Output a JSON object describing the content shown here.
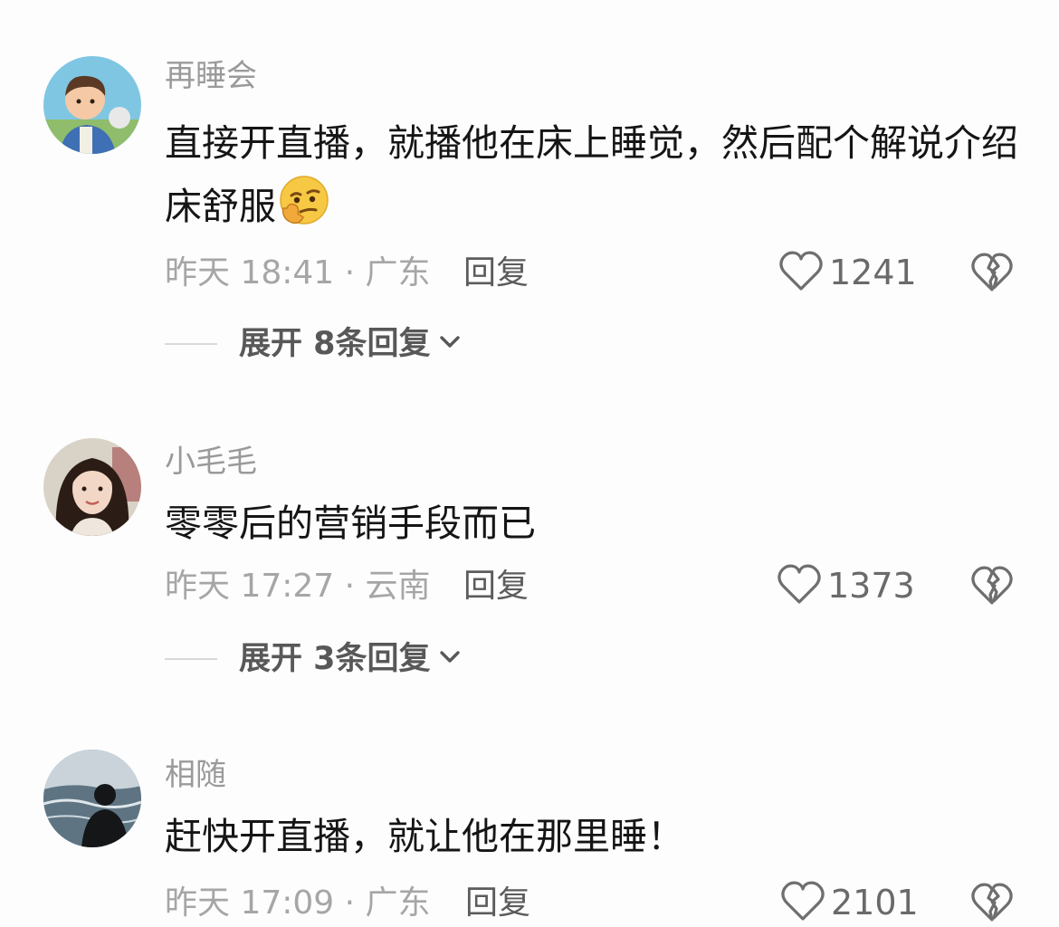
{
  "comments": [
    {
      "username": "再睡会",
      "text": "直接开直播，就播他在床上睡觉，然后配个解说介绍床舒服",
      "emoji": "thinking-smirk-face",
      "time_location": "昨天 18:41 · 广东",
      "reply_label": "回复",
      "likes": "1241",
      "expand_label": "展开 8条回复"
    },
    {
      "username": "小毛毛",
      "text": "零零后的营销手段而已",
      "time_location": "昨天 17:27 · 云南",
      "reply_label": "回复",
      "likes": "1373",
      "expand_label": "展开 3条回复"
    },
    {
      "username": "相随",
      "text": "赶快开直播，就让他在那里睡！",
      "time_location": "昨天 17:09 · 广东",
      "reply_label": "回复",
      "likes": "2101"
    }
  ],
  "icons": {
    "like": "heart-outline-icon",
    "dislike": "broken-heart-outline-icon",
    "expand": "chevron-down-icon"
  },
  "colors": {
    "background": "#fdfdfd",
    "username": "#9a9a9a",
    "meta": "#a6a6a6",
    "text": "#151515"
  }
}
